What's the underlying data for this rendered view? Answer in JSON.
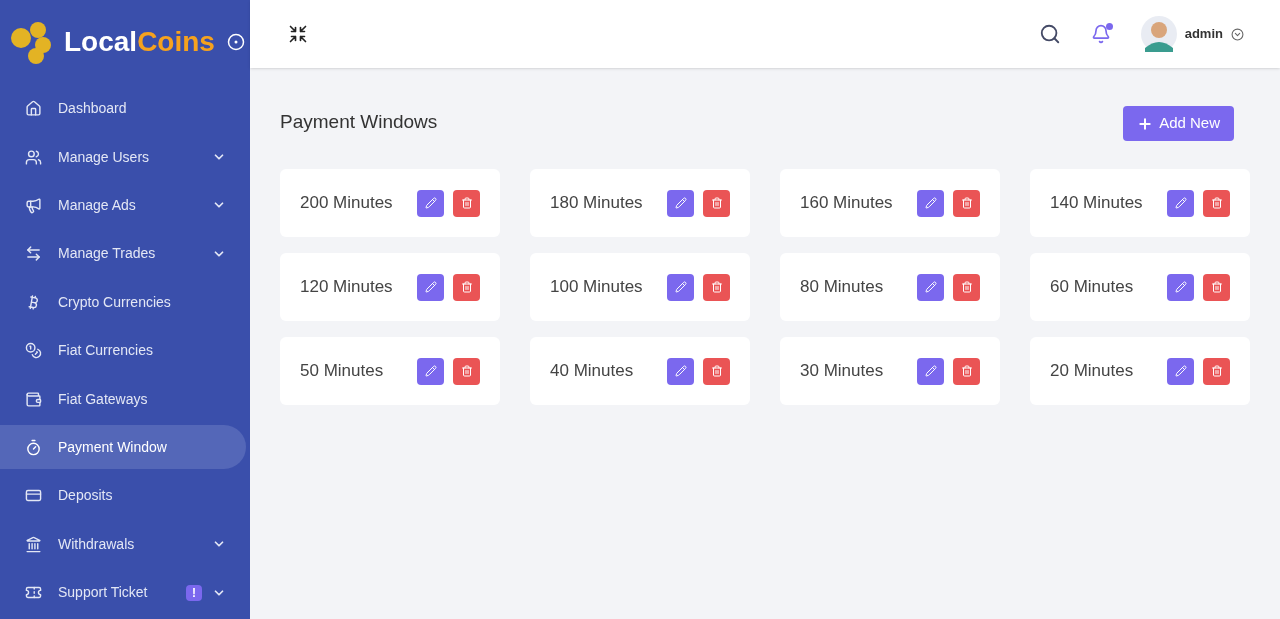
{
  "logo": {
    "primary": "Local",
    "secondary": "Coins"
  },
  "sidebar": {
    "items": [
      {
        "label": "Dashboard",
        "selected": false,
        "has_submenu": false
      },
      {
        "label": "Manage Users",
        "selected": false,
        "has_submenu": true
      },
      {
        "label": "Manage Ads",
        "selected": false,
        "has_submenu": true
      },
      {
        "label": "Manage Trades",
        "selected": false,
        "has_submenu": true
      },
      {
        "label": "Crypto Currencies",
        "selected": false,
        "has_submenu": false
      },
      {
        "label": "Fiat Currencies",
        "selected": false,
        "has_submenu": false
      },
      {
        "label": "Fiat Gateways",
        "selected": false,
        "has_submenu": false
      },
      {
        "label": "Payment Window",
        "selected": true,
        "has_submenu": false
      },
      {
        "label": "Deposits",
        "selected": false,
        "has_submenu": false
      },
      {
        "label": "Withdrawals",
        "selected": false,
        "has_submenu": true
      },
      {
        "label": "Support Ticket",
        "selected": false,
        "has_submenu": true,
        "badge": "!"
      }
    ]
  },
  "header": {
    "user": "admin",
    "notification_dot": true
  },
  "page": {
    "title": "Payment Windows",
    "add_button": "Add New",
    "cards": [
      {
        "label": "200 Minutes"
      },
      {
        "label": "180 Minutes"
      },
      {
        "label": "160 Minutes"
      },
      {
        "label": "140 Minutes"
      },
      {
        "label": "120 Minutes"
      },
      {
        "label": "100 Minutes"
      },
      {
        "label": "80 Minutes"
      },
      {
        "label": "60 Minutes"
      },
      {
        "label": "50 Minutes"
      },
      {
        "label": "40 Minutes"
      },
      {
        "label": "30 Minutes"
      },
      {
        "label": "20 Minutes"
      }
    ]
  }
}
